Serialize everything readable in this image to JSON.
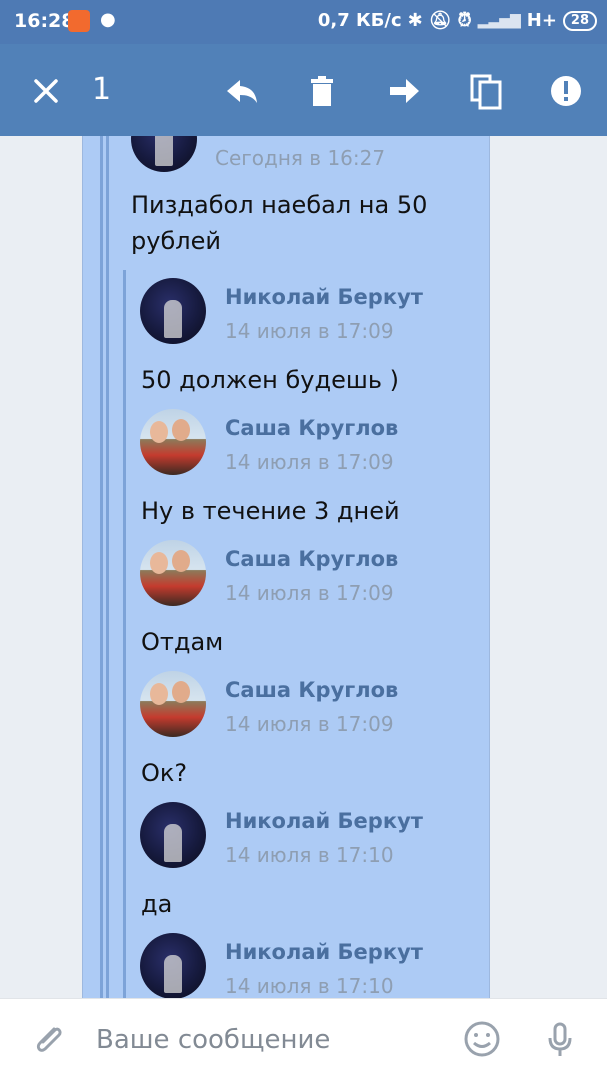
{
  "status_bar": {
    "time": "16:28",
    "network_speed": "0,7 КБ/с",
    "network_type": "H+",
    "battery": "28"
  },
  "action_bar": {
    "selected_count": "1",
    "icons": [
      "close-icon",
      "reply-icon",
      "delete-icon",
      "forward-icon",
      "copy-icon",
      "report-icon"
    ]
  },
  "top_message": {
    "date": "Сегодня в 16:27",
    "text": "Пиздабол наебал на 50\nрублей"
  },
  "forwarded": [
    {
      "author": "Николай Беркут",
      "date": "14 июля в 17:09",
      "text": "50 должен будешь )",
      "avatar": "nik"
    },
    {
      "author": "Саша Круглов",
      "date": "14 июля в 17:09",
      "text": "Ну в течение 3 дней",
      "avatar": "sasha"
    },
    {
      "author": "Саша Круглов",
      "date": "14 июля в 17:09",
      "text": "Отдам",
      "avatar": "sasha"
    },
    {
      "author": "Саша Круглов",
      "date": "14 июля в 17:09",
      "text": "Ок?",
      "avatar": "sasha"
    },
    {
      "author": "Николай Беркут",
      "date": "14 июля в 17:10",
      "text": "да",
      "avatar": "nik"
    },
    {
      "author": "Николай Беркут",
      "date": "14 июля в 17:10",
      "text": "",
      "avatar": "nik"
    }
  ],
  "input": {
    "placeholder": "Ваше сообщение"
  },
  "colors": {
    "header": "#5181b8",
    "status_bar": "#4e7ab4",
    "selected_bubble": "#adcbf5",
    "author_name": "#4a6f9f"
  }
}
